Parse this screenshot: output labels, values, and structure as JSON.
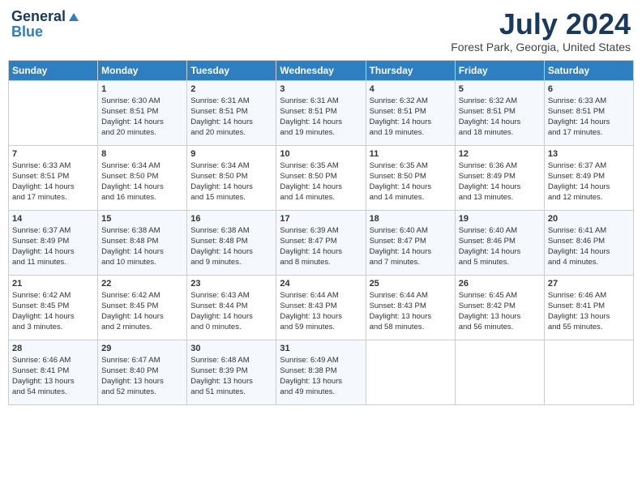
{
  "logo": {
    "line1": "General",
    "line2": "Blue"
  },
  "title": "July 2024",
  "location": "Forest Park, Georgia, United States",
  "days_header": [
    "Sunday",
    "Monday",
    "Tuesday",
    "Wednesday",
    "Thursday",
    "Friday",
    "Saturday"
  ],
  "weeks": [
    [
      {
        "day": "",
        "info": ""
      },
      {
        "day": "1",
        "info": "Sunrise: 6:30 AM\nSunset: 8:51 PM\nDaylight: 14 hours\nand 20 minutes."
      },
      {
        "day": "2",
        "info": "Sunrise: 6:31 AM\nSunset: 8:51 PM\nDaylight: 14 hours\nand 20 minutes."
      },
      {
        "day": "3",
        "info": "Sunrise: 6:31 AM\nSunset: 8:51 PM\nDaylight: 14 hours\nand 19 minutes."
      },
      {
        "day": "4",
        "info": "Sunrise: 6:32 AM\nSunset: 8:51 PM\nDaylight: 14 hours\nand 19 minutes."
      },
      {
        "day": "5",
        "info": "Sunrise: 6:32 AM\nSunset: 8:51 PM\nDaylight: 14 hours\nand 18 minutes."
      },
      {
        "day": "6",
        "info": "Sunrise: 6:33 AM\nSunset: 8:51 PM\nDaylight: 14 hours\nand 17 minutes."
      }
    ],
    [
      {
        "day": "7",
        "info": "Sunrise: 6:33 AM\nSunset: 8:51 PM\nDaylight: 14 hours\nand 17 minutes."
      },
      {
        "day": "8",
        "info": "Sunrise: 6:34 AM\nSunset: 8:50 PM\nDaylight: 14 hours\nand 16 minutes."
      },
      {
        "day": "9",
        "info": "Sunrise: 6:34 AM\nSunset: 8:50 PM\nDaylight: 14 hours\nand 15 minutes."
      },
      {
        "day": "10",
        "info": "Sunrise: 6:35 AM\nSunset: 8:50 PM\nDaylight: 14 hours\nand 14 minutes."
      },
      {
        "day": "11",
        "info": "Sunrise: 6:35 AM\nSunset: 8:50 PM\nDaylight: 14 hours\nand 14 minutes."
      },
      {
        "day": "12",
        "info": "Sunrise: 6:36 AM\nSunset: 8:49 PM\nDaylight: 14 hours\nand 13 minutes."
      },
      {
        "day": "13",
        "info": "Sunrise: 6:37 AM\nSunset: 8:49 PM\nDaylight: 14 hours\nand 12 minutes."
      }
    ],
    [
      {
        "day": "14",
        "info": "Sunrise: 6:37 AM\nSunset: 8:49 PM\nDaylight: 14 hours\nand 11 minutes."
      },
      {
        "day": "15",
        "info": "Sunrise: 6:38 AM\nSunset: 8:48 PM\nDaylight: 14 hours\nand 10 minutes."
      },
      {
        "day": "16",
        "info": "Sunrise: 6:38 AM\nSunset: 8:48 PM\nDaylight: 14 hours\nand 9 minutes."
      },
      {
        "day": "17",
        "info": "Sunrise: 6:39 AM\nSunset: 8:47 PM\nDaylight: 14 hours\nand 8 minutes."
      },
      {
        "day": "18",
        "info": "Sunrise: 6:40 AM\nSunset: 8:47 PM\nDaylight: 14 hours\nand 7 minutes."
      },
      {
        "day": "19",
        "info": "Sunrise: 6:40 AM\nSunset: 8:46 PM\nDaylight: 14 hours\nand 5 minutes."
      },
      {
        "day": "20",
        "info": "Sunrise: 6:41 AM\nSunset: 8:46 PM\nDaylight: 14 hours\nand 4 minutes."
      }
    ],
    [
      {
        "day": "21",
        "info": "Sunrise: 6:42 AM\nSunset: 8:45 PM\nDaylight: 14 hours\nand 3 minutes."
      },
      {
        "day": "22",
        "info": "Sunrise: 6:42 AM\nSunset: 8:45 PM\nDaylight: 14 hours\nand 2 minutes."
      },
      {
        "day": "23",
        "info": "Sunrise: 6:43 AM\nSunset: 8:44 PM\nDaylight: 14 hours\nand 0 minutes."
      },
      {
        "day": "24",
        "info": "Sunrise: 6:44 AM\nSunset: 8:43 PM\nDaylight: 13 hours\nand 59 minutes."
      },
      {
        "day": "25",
        "info": "Sunrise: 6:44 AM\nSunset: 8:43 PM\nDaylight: 13 hours\nand 58 minutes."
      },
      {
        "day": "26",
        "info": "Sunrise: 6:45 AM\nSunset: 8:42 PM\nDaylight: 13 hours\nand 56 minutes."
      },
      {
        "day": "27",
        "info": "Sunrise: 6:46 AM\nSunset: 8:41 PM\nDaylight: 13 hours\nand 55 minutes."
      }
    ],
    [
      {
        "day": "28",
        "info": "Sunrise: 6:46 AM\nSunset: 8:41 PM\nDaylight: 13 hours\nand 54 minutes."
      },
      {
        "day": "29",
        "info": "Sunrise: 6:47 AM\nSunset: 8:40 PM\nDaylight: 13 hours\nand 52 minutes."
      },
      {
        "day": "30",
        "info": "Sunrise: 6:48 AM\nSunset: 8:39 PM\nDaylight: 13 hours\nand 51 minutes."
      },
      {
        "day": "31",
        "info": "Sunrise: 6:49 AM\nSunset: 8:38 PM\nDaylight: 13 hours\nand 49 minutes."
      },
      {
        "day": "",
        "info": ""
      },
      {
        "day": "",
        "info": ""
      },
      {
        "day": "",
        "info": ""
      }
    ]
  ]
}
